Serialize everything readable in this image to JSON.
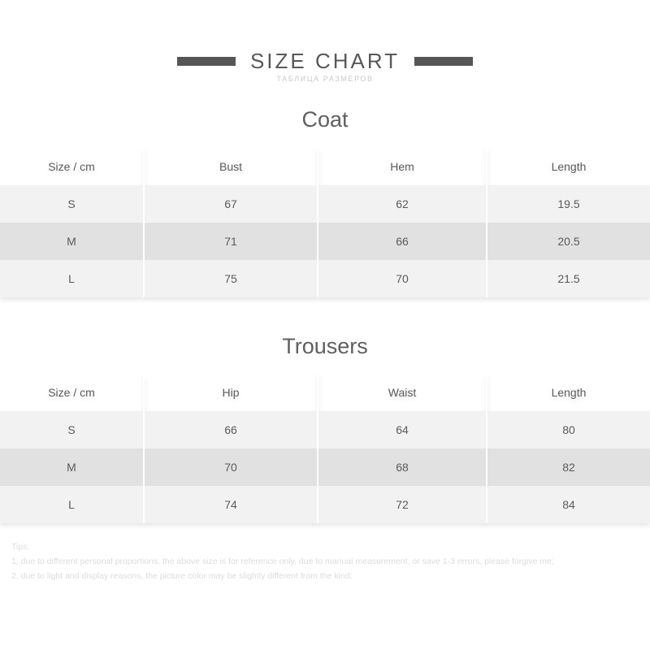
{
  "header": {
    "title": "SIZE CHART",
    "subtitle": "ТАБЛИЦА РАЗМЕРОВ",
    "bar_color": "#565656",
    "title_color": "#585858"
  },
  "sections": [
    {
      "title": "Coat",
      "columns": [
        "Size / cm",
        "Bust",
        "Hem",
        "Length"
      ],
      "rows": [
        [
          "S",
          "67",
          "62",
          "19.5"
        ],
        [
          "M",
          "71",
          "66",
          "20.5"
        ],
        [
          "L",
          "75",
          "70",
          "21.5"
        ]
      ]
    },
    {
      "title": "Trousers",
      "columns": [
        "Size / cm",
        "Hip",
        "Waist",
        "Length"
      ],
      "rows": [
        [
          "S",
          "66",
          "64",
          "80"
        ],
        [
          "M",
          "70",
          "68",
          "82"
        ],
        [
          "L",
          "74",
          "72",
          "84"
        ]
      ]
    }
  ],
  "tips": {
    "heading": "Tips:",
    "line1": "1, due to different personal proportions, the above size is for reference only, due to manual measurement, or save 1-3 errors, please forgive me;",
    "line2": "2, due to light and display reasons, the picture color may be slightly different from the kind;"
  },
  "colors": {
    "header_row_bg": "#e1e1e1",
    "alt_row_bg": "#e1e1e1",
    "light_row_bg": "#f2f2f2",
    "text": "#5a5a5a",
    "tips_text": "#dcdcdc"
  }
}
